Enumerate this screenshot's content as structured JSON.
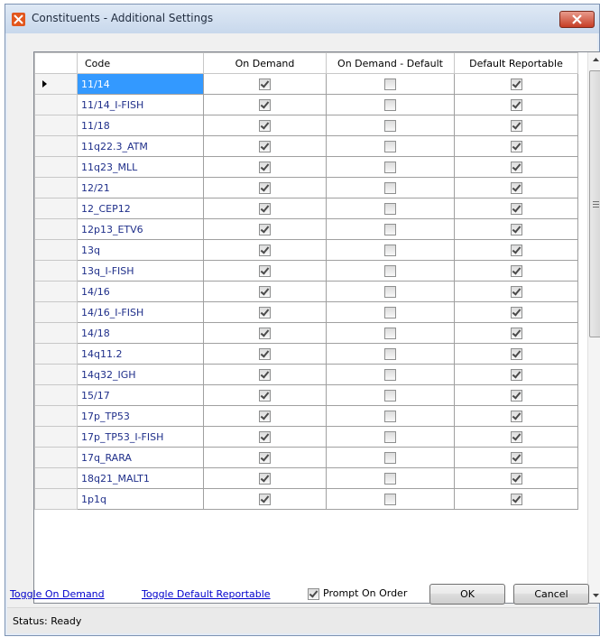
{
  "window": {
    "title": "Constituents - Additional Settings"
  },
  "grid": {
    "columns": [
      "Code",
      "On Demand",
      "On Demand - Default",
      "Default Reportable"
    ],
    "selected_row": 0,
    "rows": [
      {
        "code": "11/14",
        "on_demand": true,
        "on_demand_default": false,
        "default_reportable": true
      },
      {
        "code": "11/14_I-FISH",
        "on_demand": true,
        "on_demand_default": false,
        "default_reportable": true
      },
      {
        "code": "11/18",
        "on_demand": true,
        "on_demand_default": false,
        "default_reportable": true
      },
      {
        "code": "11q22.3_ATM",
        "on_demand": true,
        "on_demand_default": false,
        "default_reportable": true
      },
      {
        "code": "11q23_MLL",
        "on_demand": true,
        "on_demand_default": false,
        "default_reportable": true
      },
      {
        "code": "12/21",
        "on_demand": true,
        "on_demand_default": false,
        "default_reportable": true
      },
      {
        "code": "12_CEP12",
        "on_demand": true,
        "on_demand_default": false,
        "default_reportable": true
      },
      {
        "code": "12p13_ETV6",
        "on_demand": true,
        "on_demand_default": false,
        "default_reportable": true
      },
      {
        "code": "13q",
        "on_demand": true,
        "on_demand_default": false,
        "default_reportable": true
      },
      {
        "code": "13q_I-FISH",
        "on_demand": true,
        "on_demand_default": false,
        "default_reportable": true
      },
      {
        "code": "14/16",
        "on_demand": true,
        "on_demand_default": false,
        "default_reportable": true
      },
      {
        "code": "14/16_I-FISH",
        "on_demand": true,
        "on_demand_default": false,
        "default_reportable": true
      },
      {
        "code": "14/18",
        "on_demand": true,
        "on_demand_default": false,
        "default_reportable": true
      },
      {
        "code": "14q11.2",
        "on_demand": true,
        "on_demand_default": false,
        "default_reportable": true
      },
      {
        "code": "14q32_IGH",
        "on_demand": true,
        "on_demand_default": false,
        "default_reportable": true
      },
      {
        "code": "15/17",
        "on_demand": true,
        "on_demand_default": false,
        "default_reportable": true
      },
      {
        "code": "17p_TP53",
        "on_demand": true,
        "on_demand_default": false,
        "default_reportable": true
      },
      {
        "code": "17p_TP53_I-FISH",
        "on_demand": true,
        "on_demand_default": false,
        "default_reportable": true
      },
      {
        "code": "17q_RARA",
        "on_demand": true,
        "on_demand_default": false,
        "default_reportable": true
      },
      {
        "code": "18q21_MALT1",
        "on_demand": true,
        "on_demand_default": false,
        "default_reportable": true
      },
      {
        "code": "1p1q",
        "on_demand": true,
        "on_demand_default": false,
        "default_reportable": true
      }
    ]
  },
  "footer": {
    "toggle_on_demand": "Toggle On Demand",
    "toggle_default_reportable": "Toggle Default Reportable",
    "prompt_on_order_label": "Prompt On Order",
    "prompt_on_order_checked": true,
    "ok_label": "OK",
    "cancel_label": "Cancel"
  },
  "status": {
    "text": "Status: Ready"
  },
  "colors": {
    "selection": "#3399ff",
    "link": "#0000cc",
    "code_text": "#1f2f8a",
    "close_button": "#c63d25"
  }
}
